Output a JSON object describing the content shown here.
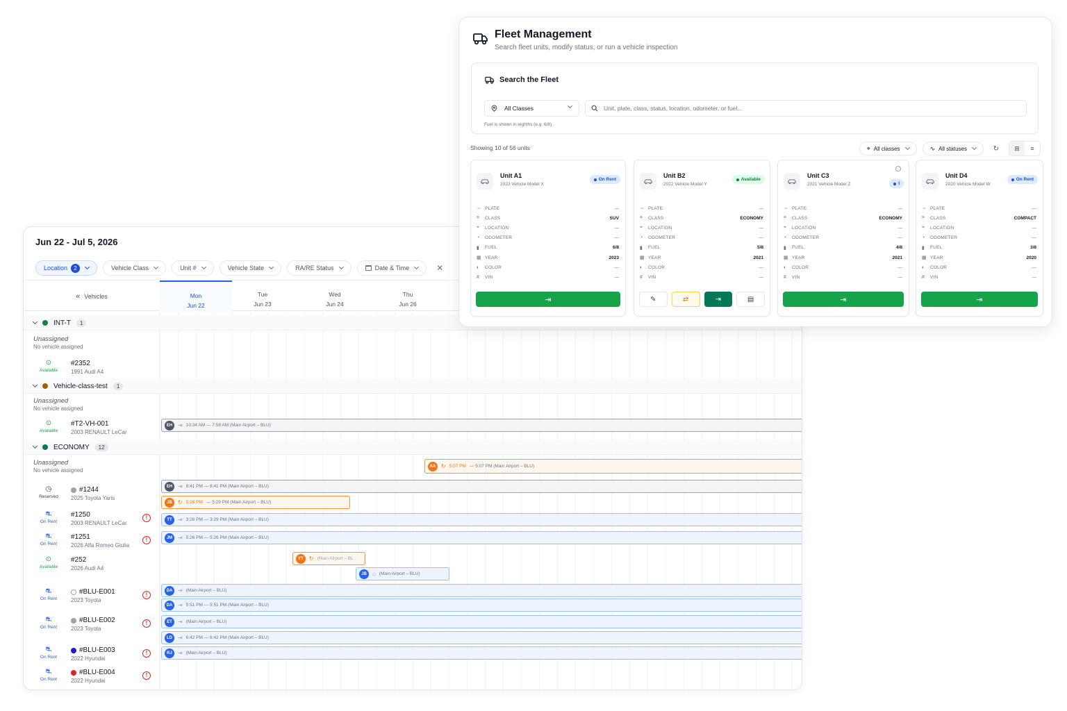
{
  "scheduler": {
    "date_range": "Jun 22 - Jul 5, 2026",
    "filters": {
      "location_label": "Location",
      "location_count": "2",
      "vehicle_class": "Vehicle Class",
      "unit": "Unit #",
      "vehicle_state": "Vehicle State",
      "ra_status": "RA/RE Status",
      "date_time": "Date & Time"
    },
    "vehicles_header": "Vehicles",
    "days": [
      {
        "dow": "Mon",
        "date": "Jun 22"
      },
      {
        "dow": "Tue",
        "date": "Jun 23"
      },
      {
        "dow": "Wed",
        "date": "Jun 24"
      },
      {
        "dow": "Thu",
        "date": "Jun 26"
      }
    ],
    "unassigned_title": "Unassigned",
    "unassigned_sub": "No vehicle assigned",
    "groups": [
      {
        "name": "INT-T",
        "count": "1",
        "color": "#15803d"
      },
      {
        "name": "Vehicle-class-test",
        "count": "1",
        "color": "#a16207"
      },
      {
        "name": "ECONOMY",
        "count": "12",
        "color": "#047857"
      }
    ],
    "vehicles": [
      {
        "unit": "#2352",
        "model": "1991 Audi A4",
        "status": "Available"
      },
      {
        "unit": "#T2-VH-001",
        "model": "2003 RENAULT LeCar",
        "status": "Available"
      },
      {
        "unit": "#1244",
        "model": "2025 Toyota Yaris",
        "status": "Reserved",
        "dot": "#9ca3af"
      },
      {
        "unit": "#1250",
        "model": "2003 RENAULT LeCar",
        "status": "On Rent"
      },
      {
        "unit": "#1251",
        "model": "2026 Alfa Romeo Giulia",
        "status": "On Rent"
      },
      {
        "unit": "#252",
        "model": "2026 Audi A4",
        "status": "Available"
      },
      {
        "unit": "#BLU-E001",
        "model": "2023 Toyota",
        "status": "On Rent",
        "dot": "#ffffff"
      },
      {
        "unit": "#BLU-E002",
        "model": "2023 Toyota",
        "status": "On Rent",
        "dot": "#9ca3af"
      },
      {
        "unit": "#BLU-E003",
        "model": "2022 Hyundai",
        "status": "On Rent",
        "dot": "#1e1bd6"
      },
      {
        "unit": "#BLU-E004",
        "model": "2022 Hyundai",
        "status": "On Rent",
        "dot": "#dc2626"
      }
    ],
    "bookings": [
      {
        "initials": "EH",
        "text": "10:34 AM — 7:58 AM (Main Airport – BLU)"
      },
      {
        "initials": "AA",
        "text_accent": "5:07 PM",
        "text": "— 5:07 PM (Main Airport – BLU)"
      },
      {
        "initials": "EH",
        "text": "8:41 PM — 8:41 PM (Main Airport – BLU)"
      },
      {
        "initials": "JB",
        "text_accent": "5:26 PM",
        "text": "— 5:29 PM (Main Airport – BLU)"
      },
      {
        "initials": "TT",
        "text": "3:26 PM — 3:29 PM (Main Airport – BLU)"
      },
      {
        "initials": "JM",
        "text": "5:26 PM — 5:26 PM (Main Airport – BLU)"
      },
      {
        "initials": "YT",
        "text": "(Main Airport – BL"
      },
      {
        "initials": "JB",
        "text": "(Main Airport – BLU)"
      },
      {
        "initials": "DA",
        "text": "(Main Airport – BLU)"
      },
      {
        "initials": "DA",
        "text": "5:51 PM — 5:51 PM (Main Airport – BLU)"
      },
      {
        "initials": "ET",
        "text": "(Main Airport – BLU)"
      },
      {
        "initials": "LD",
        "text": "6:42 PM — 6:42 PM (Main Airport – BLU)"
      },
      {
        "initials": "RJ",
        "text": "(Main Airport – BLU)"
      }
    ]
  },
  "fleet": {
    "title": "Fleet Management",
    "subtitle": "Search fleet units, modify status, or run a vehicle inspection",
    "search": {
      "title": "Search the Fleet",
      "class_select": "All Classes",
      "placeholder": "Unit, plate, class, status, location, odometer, or fuel...",
      "fuel_note": "Fuel is shown in eighths (e.g. 6/8)."
    },
    "showing": "Showing 10 of 56 units",
    "filter_classes": "All classes",
    "filter_statuses": "All statuses",
    "field_labels": [
      "PLATE",
      "CLASS",
      "LOCATION",
      "ODOMETER",
      "FUEL",
      "YEAR",
      "COLOR",
      "VIN"
    ],
    "units": [
      {
        "name": "Unit A1",
        "model": "2023 Vehicle Model X",
        "badge": "On Rent",
        "values": [
          "—",
          "SUV",
          "—",
          "—",
          "6/8",
          "2023",
          "—",
          "—"
        ]
      },
      {
        "name": "Unit B2",
        "model": "2022 Vehicle Model Y",
        "badge": "Available",
        "values": [
          "—",
          "ECONOMY",
          "—",
          "—",
          "5/8",
          "2021",
          "—",
          "—"
        ]
      },
      {
        "name": "Unit C3",
        "model": "2021 Vehicle Model Z",
        "badge": "I",
        "values": [
          "—",
          "ECONOMY",
          "—",
          "—",
          "4/8",
          "2021",
          "—",
          "—"
        ]
      },
      {
        "name": "Unit D4",
        "model": "2020 Vehicle Model W",
        "badge": "On Rent",
        "values": [
          "—",
          "COMPACT",
          "—",
          "—",
          "3/8",
          "2020",
          "—",
          "—"
        ]
      }
    ]
  }
}
